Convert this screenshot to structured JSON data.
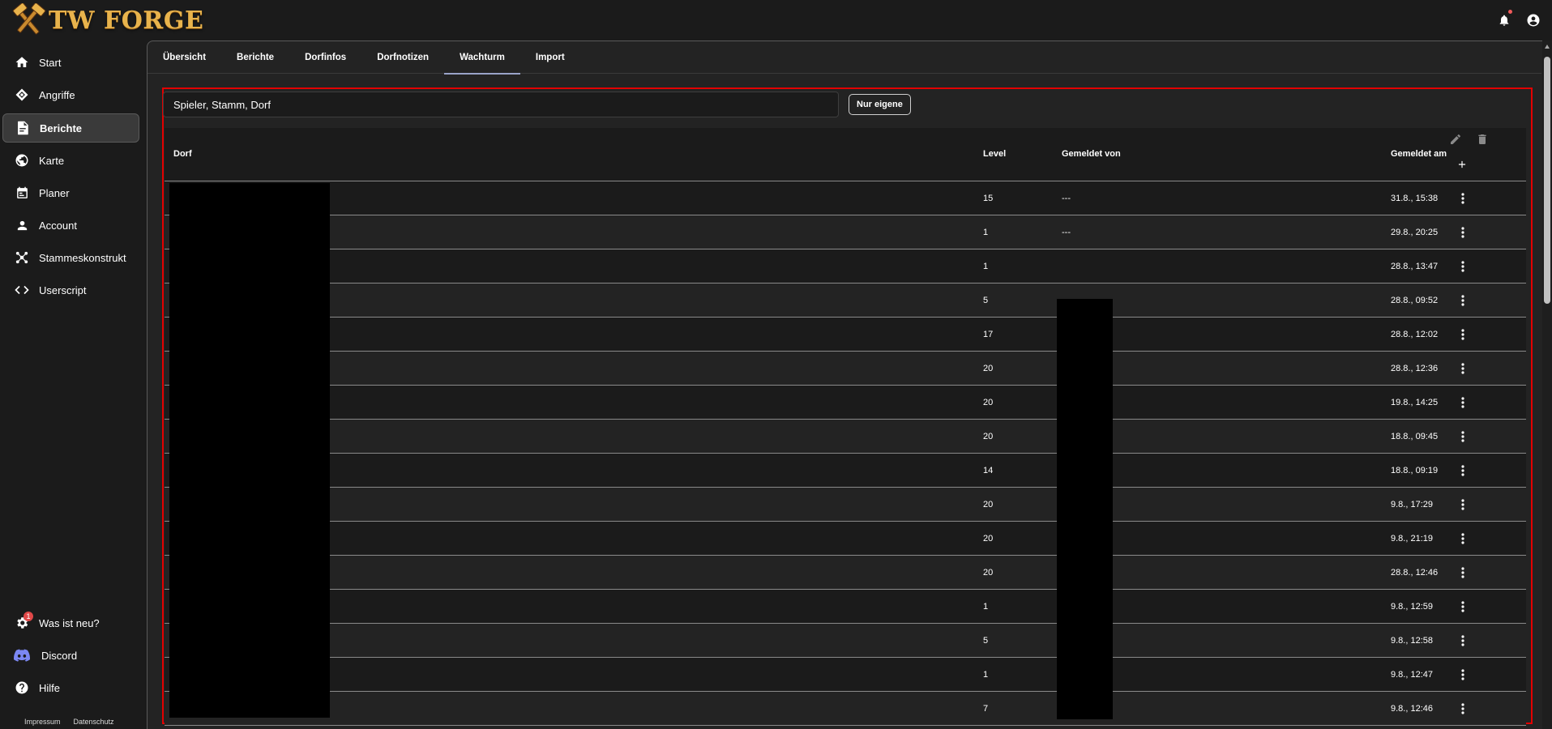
{
  "app": {
    "name": "TW FORGE"
  },
  "sidebar": {
    "items": [
      {
        "label": "Start",
        "icon": "home-icon"
      },
      {
        "label": "Angriffe",
        "icon": "target-icon"
      },
      {
        "label": "Berichte",
        "icon": "report-icon",
        "active": true
      },
      {
        "label": "Karte",
        "icon": "globe-icon"
      },
      {
        "label": "Planer",
        "icon": "calendar-icon"
      },
      {
        "label": "Account",
        "icon": "person-icon"
      },
      {
        "label": "Stammeskonstrukt",
        "icon": "network-icon"
      },
      {
        "label": "Userscript",
        "icon": "code-icon"
      }
    ],
    "bottom_items": [
      {
        "label": "Was ist neu?",
        "icon": "gear-badge-icon",
        "badge": "1"
      },
      {
        "label": "Discord",
        "icon": "discord-icon"
      },
      {
        "label": "Hilfe",
        "icon": "help-icon"
      }
    ],
    "footer": {
      "impressum": "Impressum",
      "datenschutz": "Datenschutz"
    }
  },
  "tabs": [
    "Übersicht",
    "Berichte",
    "Dorfinfos",
    "Dorfnotizen",
    "Wachturm",
    "Import"
  ],
  "active_tab": "Wachturm",
  "search": {
    "value": "Spieler, Stamm, Dorf"
  },
  "filter_button": "Nur eigene",
  "table": {
    "columns": {
      "dorf": "Dorf",
      "level": "Level",
      "gemeldet_von": "Gemeldet von",
      "gemeldet_am": "Gemeldet am"
    },
    "rows": [
      {
        "level": "15",
        "von": "---",
        "am": "31.8., 15:38"
      },
      {
        "level": "1",
        "von": "---",
        "am": "29.8., 20:25"
      },
      {
        "level": "1",
        "von": "",
        "am": "28.8., 13:47"
      },
      {
        "level": "5",
        "von": "",
        "am": "28.8., 09:52"
      },
      {
        "level": "17",
        "von": "",
        "am": "28.8., 12:02"
      },
      {
        "level": "20",
        "von": "",
        "am": "28.8., 12:36"
      },
      {
        "level": "20",
        "von": "",
        "am": "19.8., 14:25"
      },
      {
        "level": "20",
        "von": "",
        "am": "18.8., 09:45"
      },
      {
        "level": "14",
        "von": "",
        "am": "18.8., 09:19"
      },
      {
        "level": "20",
        "von": "",
        "am": "9.8., 17:29"
      },
      {
        "level": "20",
        "von": "",
        "am": "9.8., 21:19"
      },
      {
        "level": "20",
        "von": "",
        "am": "28.8., 12:46"
      },
      {
        "level": "1",
        "von": "",
        "am": "9.8., 12:59"
      },
      {
        "level": "5",
        "von": "",
        "am": "9.8., 12:58"
      },
      {
        "level": "1",
        "von": "",
        "am": "9.8., 12:47"
      },
      {
        "level": "7",
        "von": "",
        "am": "9.8., 12:46"
      }
    ]
  }
}
